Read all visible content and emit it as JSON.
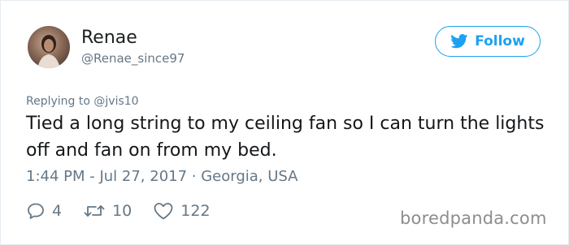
{
  "user": {
    "name": "Renae",
    "handle": "@Renae_since97"
  },
  "follow_button": {
    "label": "Follow",
    "icon": "twitter-bird-icon",
    "color": "#1da1f2"
  },
  "tweet": {
    "replying_prefix": "Replying to",
    "replying_to": "@jvis10",
    "text": "Tied a long string to my ceiling fan so I can turn the lights off and fan on from my bed.",
    "timestamp": "1:44 PM - Jul 27, 2017 · Georgia, USA"
  },
  "actions": {
    "replies": {
      "icon": "reply-icon",
      "count": "4"
    },
    "retweets": {
      "icon": "retweet-icon",
      "count": "10"
    },
    "likes": {
      "icon": "heart-icon",
      "count": "122"
    }
  },
  "watermark": "boredpanda.com"
}
